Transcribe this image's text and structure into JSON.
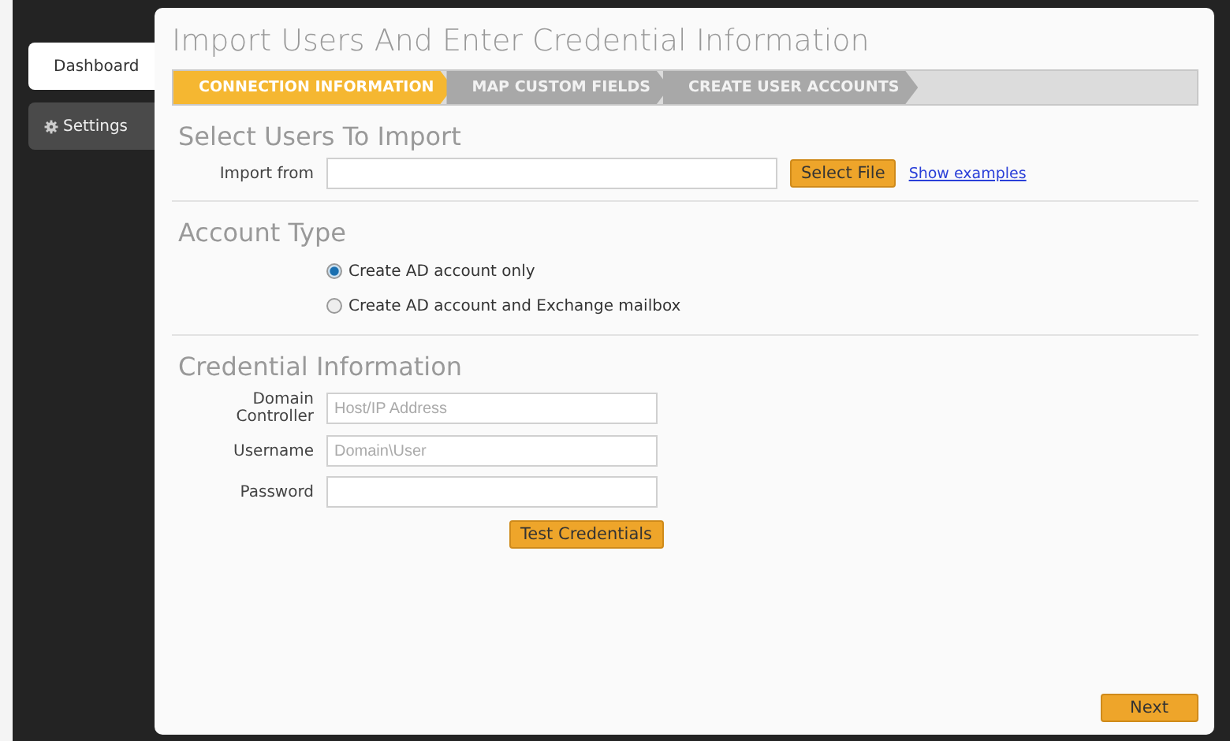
{
  "sidebar": {
    "items": [
      {
        "label": "Dashboard",
        "selected": true,
        "kind": "plain"
      },
      {
        "label": "Settings",
        "selected": false,
        "kind": "gear"
      }
    ]
  },
  "title": "Import Users And Enter Credential Information",
  "steps": [
    {
      "label": "CONNECTION INFORMATION",
      "selected": true
    },
    {
      "label": "MAP CUSTOM FIELDS",
      "selected": false
    },
    {
      "label": "CREATE USER ACCOUNTS",
      "selected": false
    }
  ],
  "select_users": {
    "heading": "Select Users To Import",
    "label": "Import from",
    "button": "Select File",
    "link": "Show examples"
  },
  "account_type": {
    "heading": "Account Type",
    "options": [
      {
        "label": "Create AD account only",
        "selected": true
      },
      {
        "label": "Create AD account and Exchange mailbox",
        "selected": false
      }
    ]
  },
  "credentials": {
    "heading": "Credential Information",
    "fields": [
      {
        "label": "Domain Controller",
        "placeholder": "Host/IP Address"
      },
      {
        "label": "Username",
        "placeholder": "Domain\\User"
      },
      {
        "label": "Password"
      }
    ],
    "button": "Test Credentials"
  },
  "next_button": "Next"
}
